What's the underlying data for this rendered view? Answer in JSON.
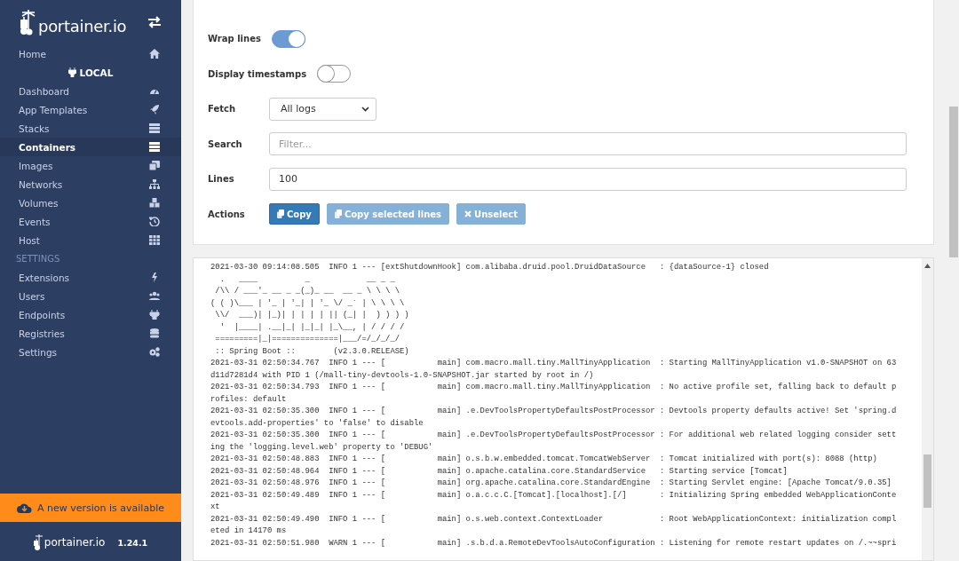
{
  "sidebar": {
    "logo": "portainer.io",
    "items": [
      {
        "label": "Home",
        "selected": false
      }
    ],
    "endpoint": "LOCAL",
    "endpoint_items": [
      {
        "label": "Dashboard",
        "selected": false
      },
      {
        "label": "App Templates",
        "selected": false
      },
      {
        "label": "Stacks",
        "selected": false
      },
      {
        "label": "Containers",
        "selected": true
      },
      {
        "label": "Images",
        "selected": false
      },
      {
        "label": "Networks",
        "selected": false
      },
      {
        "label": "Volumes",
        "selected": false
      },
      {
        "label": "Events",
        "selected": false
      },
      {
        "label": "Host",
        "selected": false
      }
    ],
    "settings_header": "SETTINGS",
    "settings_items": [
      {
        "label": "Extensions",
        "selected": false
      },
      {
        "label": "Users",
        "selected": false
      },
      {
        "label": "Endpoints",
        "selected": false
      },
      {
        "label": "Registries",
        "selected": false
      },
      {
        "label": "Settings",
        "selected": false
      }
    ],
    "update_banner": "A new version is available",
    "footer": {
      "logo": "portainer.io",
      "version": "1.24.1"
    }
  },
  "log_options": {
    "toggles": [
      {
        "label": "Wrap lines",
        "on": true
      },
      {
        "label": "Display timestamps",
        "on": false
      }
    ],
    "fetch": {
      "label": "Fetch",
      "value": "All logs"
    },
    "search": {
      "label": "Search",
      "placeholder": "Filter..."
    },
    "lines": {
      "label": "Lines",
      "value": "100"
    },
    "actions": {
      "label": "Actions",
      "buttons": [
        {
          "label": "Copy",
          "disabled": false
        },
        {
          "label": "Copy selected lines",
          "disabled": true
        },
        {
          "label": "Unselect",
          "disabled": true
        }
      ]
    }
  },
  "log_lines": [
    "2021-03-30 09:14:08.505  INFO 1 --- [extShutdownHook] com.alibaba.druid.pool.DruidDataSource   : {dataSource-1} closed",
    "  .   ____          _            __ _ _",
    " /\\\\ / ___'_ __ _ _(_)_ __  __ _ \\ \\ \\ \\",
    "( ( )\\___ | '_ | '_| | '_ \\/ _` | \\ \\ \\ \\",
    " \\\\/  ___)| |_)| | | | | || (_| |  ) ) ) )",
    "  '  |____| .__|_| |_|_| |_\\__, | / / / /",
    " =========|_|==============|___/=/_/_/_/",
    " :: Spring Boot ::        (v2.3.0.RELEASE)",
    "2021-03-31 02:50:34.767  INFO 1 --- [           main] com.macro.mall.tiny.MallTinyApplication  : Starting MallTinyApplication v1.0-SNAPSHOT on 63",
    "d11d7281d4 with PID 1 (/mall-tiny-devtools-1.0-SNAPSHOT.jar started by root in /)",
    "2021-03-31 02:50:34.793  INFO 1 --- [           main] com.macro.mall.tiny.MallTinyApplication  : No active profile set, falling back to default p",
    "rofiles: default",
    "2021-03-31 02:50:35.300  INFO 1 --- [           main] .e.DevToolsPropertyDefaultsPostProcessor : Devtools property defaults active! Set 'spring.d",
    "evtools.add-properties' to 'false' to disable",
    "2021-03-31 02:50:35.300  INFO 1 --- [           main] .e.DevToolsPropertyDefaultsPostProcessor : For additional web related logging consider sett",
    "ing the 'logging.level.web' property to 'DEBUG'",
    "2021-03-31 02:50:48.883  INFO 1 --- [           main] o.s.b.w.embedded.tomcat.TomcatWebServer  : Tomcat initialized with port(s): 8088 (http)",
    "2021-03-31 02:50:48.964  INFO 1 --- [           main] o.apache.catalina.core.StandardService   : Starting service [Tomcat]",
    "2021-03-31 02:50:48.976  INFO 1 --- [           main] org.apache.catalina.core.StandardEngine  : Starting Servlet engine: [Apache Tomcat/9.0.35]",
    "2021-03-31 02:50:49.489  INFO 1 --- [           main] o.a.c.c.C.[Tomcat].[localhost].[/]       : Initializing Spring embedded WebApplicationConte",
    "xt",
    "2021-03-31 02:50:49.490  INFO 1 --- [           main] o.s.web.context.ContextLoader            : Root WebApplicationContext: initialization compl",
    "eted in 14170 ms",
    "2021-03-31 02:50:51.980  WARN 1 --- [           main] .s.b.d.a.RemoteDevToolsAutoConfiguration : Listening for remote restart updates on /.~~spri"
  ]
}
